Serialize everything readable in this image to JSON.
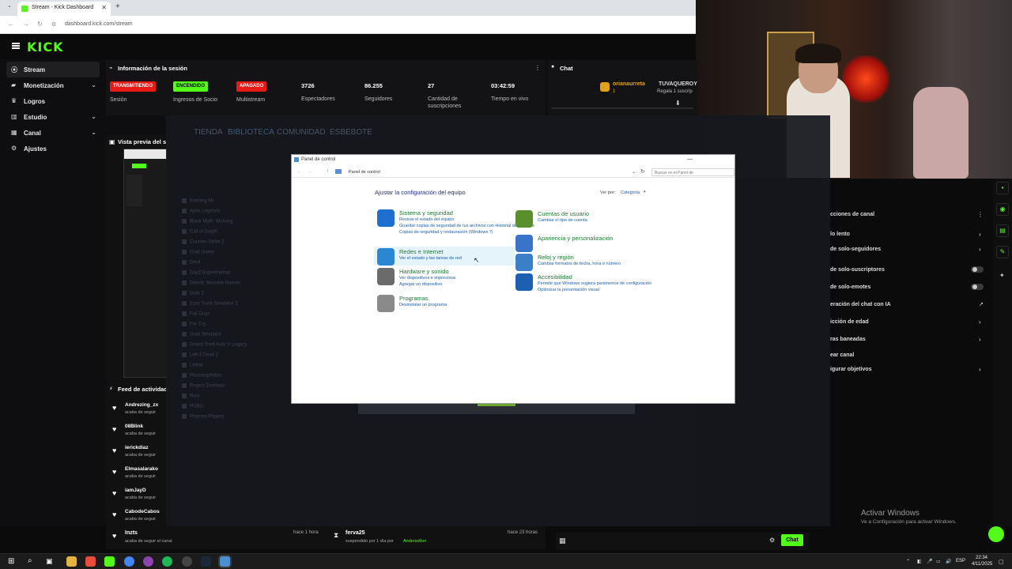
{
  "browser": {
    "tab_title": "Stream - Kick Dashboard",
    "url": "dashboard.kick.com/stream"
  },
  "kick": {
    "logo": "KICK",
    "sidebar": [
      {
        "label": "Stream",
        "icon": "broadcast-icon",
        "active": true,
        "chevron": false
      },
      {
        "label": "Monetización",
        "icon": "money-icon",
        "active": false,
        "chevron": true
      },
      {
        "label": "Logros",
        "icon": "trophy-icon",
        "active": false,
        "chevron": false
      },
      {
        "label": "Estudio",
        "icon": "studio-icon",
        "active": false,
        "chevron": true
      },
      {
        "label": "Canal",
        "icon": "channel-icon",
        "active": false,
        "chevron": true
      },
      {
        "label": "Ajustes",
        "icon": "gear-icon",
        "active": false,
        "chevron": false
      }
    ],
    "session": {
      "title": "Información de la sesión",
      "badges": [
        {
          "text": "TRANSMITIENDO",
          "label": "Sesión",
          "color": "#e91916",
          "text_color": "#ffffff"
        },
        {
          "text": "ENCENDIDO",
          "label": "Ingresos de Socio",
          "color": "#53fc18",
          "text_color": "#000000"
        },
        {
          "text": "APAGADO",
          "label": "Multistream",
          "color": "#e91916",
          "text_color": "#ffffff"
        }
      ],
      "stats": [
        {
          "value": "3726",
          "label": "Espectadores"
        },
        {
          "value": "86.255",
          "label": "Seguidores"
        },
        {
          "value": "27",
          "label": "Cantidad de suscripciones"
        },
        {
          "value": "03:42:59",
          "label": "Tiempo en vivo"
        }
      ]
    },
    "chat": {
      "title": "Chat",
      "user1": "orianaurreta",
      "user1_badge": "1",
      "user2": "TUVAQUEROY",
      "user2_note": "Regala 1 suscrip",
      "send_label": "Chat"
    },
    "preview_title": "Vista previa del s",
    "feed": {
      "title": "Feed de actividad",
      "items": [
        {
          "name": "Andrezing_zx",
          "action": "acaba de seguir"
        },
        {
          "name": "08Blink",
          "action": "acaba de seguir"
        },
        {
          "name": "ierickdiaz",
          "action": "acaba de seguir"
        },
        {
          "name": "Elmasalarako",
          "action": "acaba de seguir"
        },
        {
          "name": "iamJayD",
          "action": "acaba de seguir"
        },
        {
          "name": "CabodeCabos",
          "action": "acaba de seguir"
        }
      ],
      "last": {
        "name": "Inzts",
        "action": "acaba de seguir el canal",
        "time": "hace 1 hora"
      },
      "mod": {
        "name": "ferva25",
        "action": "suspendido por 1 día por",
        "by": "Anderss0on",
        "time": "hace 23 horas"
      }
    },
    "channel_options": {
      "title": "cciones de canal",
      "items": [
        {
          "label": "lo lento",
          "control": "arrow"
        },
        {
          "label": "de solo-seguidores",
          "control": "arrow"
        },
        {
          "label": "de solo-suscriptores",
          "control": "toggle"
        },
        {
          "label": "de solo-emotes",
          "control": "toggle"
        },
        {
          "label": "eración del chat con IA",
          "control": "external"
        },
        {
          "label": "icción de edad",
          "control": "arrow"
        },
        {
          "label": "ras baneadas",
          "control": "arrow"
        },
        {
          "label": "ear canal",
          "control": "none"
        },
        {
          "label": "igurar objetivos",
          "control": "arrow"
        }
      ]
    }
  },
  "steam": {
    "nav": [
      "TIENDA",
      "BIBLIOTECA",
      "COMUNIDAD",
      "ESBEBOTE"
    ],
    "games": [
      "Evening Mi",
      "Apex Legends",
      "Black Myth: Wukong",
      "Call of Duty®",
      "Counter-Strike 2",
      "Crab Game",
      "Devil",
      "DayZ Experimental",
      "Detroit: Become Human",
      "Dota 2",
      "Euro Truck Simulator 2",
      "Fall Guys",
      "Far Cry",
      "Goat Simulator",
      "Grand Theft Auto V Legacy",
      "Left 4 Dead 2",
      "Lethal",
      "Phasmophobia",
      "Project Zomboid",
      "Rust",
      "PUBG",
      "Phasmo Players"
    ]
  },
  "control_panel": {
    "title": "Panel de control",
    "breadcrumb": "Panel de control",
    "search_placeholder": "Buscar en el Panel de",
    "heading": "Ajustar la configuración del equipo",
    "view_by_label": "Ver por:",
    "view_by_value": "Categoría",
    "left": [
      {
        "title": "Sistema y seguridad",
        "icon": "shield-icon",
        "color": "#1f6fd1",
        "links": [
          "Revisar el estado del equipo",
          "Guardar copias de seguridad de tus archivos con Historial de archivos",
          "Copias de seguridad y restauración (Windows 7)"
        ]
      },
      {
        "title": "Redes e Internet",
        "icon": "network-icon",
        "color": "#2b87d3",
        "links": [
          "Ver el estado y las tareas de red"
        ]
      },
      {
        "title": "Hardware y sonido",
        "icon": "printer-icon",
        "color": "#6b6b6b",
        "links": [
          "Ver dispositivos e impresoras",
          "Agregar un dispositivo"
        ]
      },
      {
        "title": "Programas",
        "icon": "programs-icon",
        "color": "#8a8a8a",
        "links": [
          "Desinstalar un programa"
        ]
      }
    ],
    "right": [
      {
        "title": "Cuentas de usuario",
        "icon": "users-icon",
        "color": "#5a8f2e",
        "links": [
          "Cambiar el tipo de cuenta"
        ]
      },
      {
        "title": "Apariencia y personalización",
        "icon": "appearance-icon",
        "color": "#3a74c9",
        "links": []
      },
      {
        "title": "Reloj y región",
        "icon": "clock-icon",
        "color": "#3b7fc8",
        "links": [
          "Cambiar formatos de fecha, hora o número"
        ]
      },
      {
        "title": "Accesibilidad",
        "icon": "accessibility-icon",
        "color": "#1d5fb0",
        "links": [
          "Permite que Windows sugiera parámetros de configuración",
          "Optimizar la presentación visual"
        ]
      }
    ]
  },
  "windows": {
    "activate_title": "Activar Windows",
    "activate_sub": "Ve a Configuración para activar Windows.",
    "lang": "ESP",
    "time": "22:34",
    "date": "4/11/2025"
  }
}
